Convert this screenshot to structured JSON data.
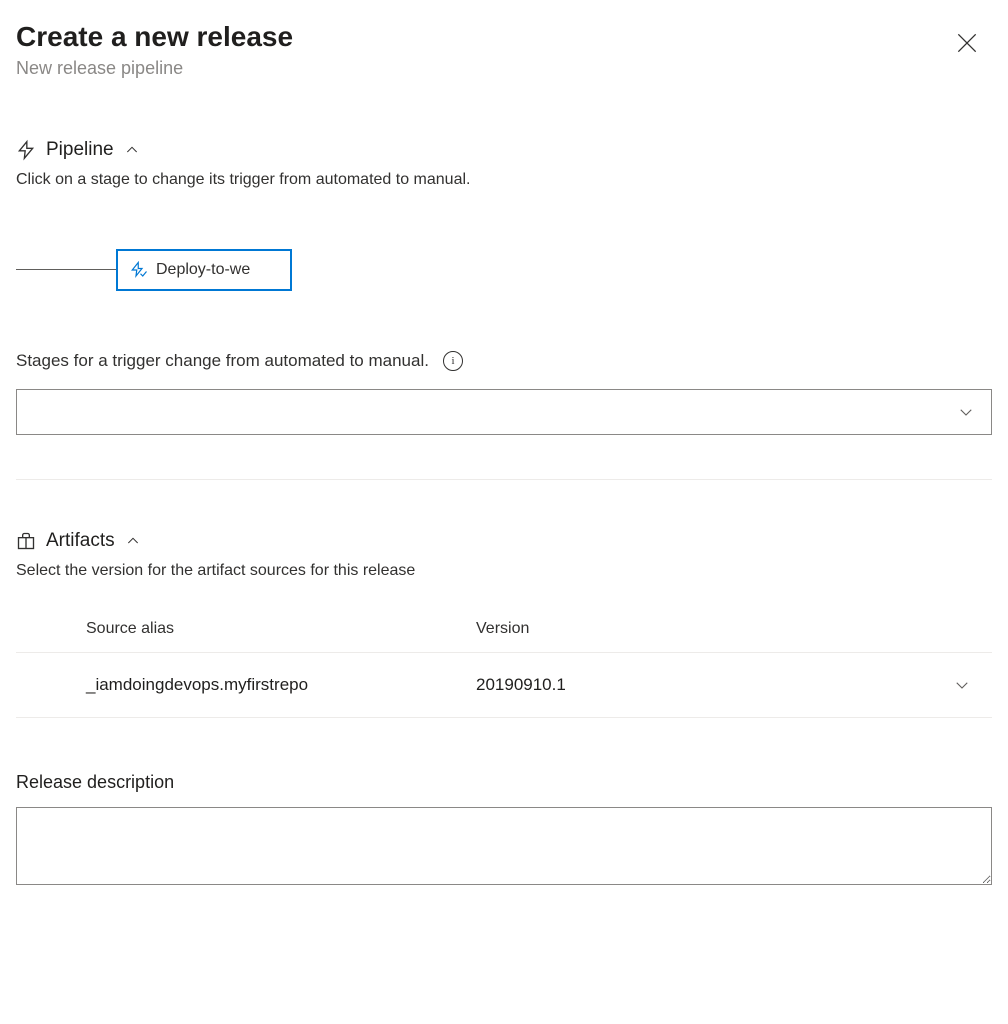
{
  "header": {
    "title": "Create a new release",
    "subtitle": "New release pipeline"
  },
  "pipeline": {
    "section_title": "Pipeline",
    "description": "Click on a stage to change its trigger from automated to manual.",
    "stage_label": "Deploy-to-we",
    "stages_trigger_label": "Stages for a trigger change from automated to manual.",
    "stages_trigger_value": ""
  },
  "artifacts": {
    "section_title": "Artifacts",
    "description": "Select the version for the artifact sources for this release",
    "header_alias": "Source alias",
    "header_version": "Version",
    "rows": [
      {
        "alias": "_iamdoingdevops.myfirstrepo",
        "version": "20190910.1"
      }
    ]
  },
  "release_description": {
    "label": "Release description",
    "value": ""
  }
}
